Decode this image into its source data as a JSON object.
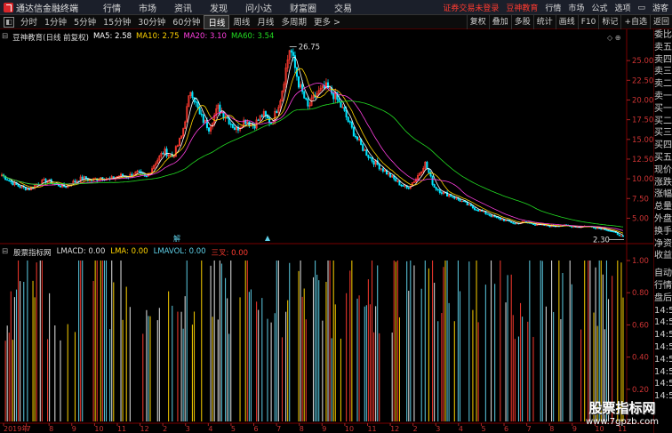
{
  "app": {
    "title": "通达信金融终端"
  },
  "top_menu": [
    "行情",
    "市场",
    "资讯",
    "发现",
    "问小达",
    "财富圈",
    "交易"
  ],
  "top_right": {
    "notice": "证券交易未登录",
    "brand": "豆神教育",
    "items": [
      "行情",
      "市场",
      "公式",
      "选项"
    ],
    "user": "游客"
  },
  "periods": [
    {
      "label": "分时",
      "active": false
    },
    {
      "label": "1分钟",
      "active": false
    },
    {
      "label": "5分钟",
      "active": false
    },
    {
      "label": "15分钟",
      "active": false
    },
    {
      "label": "30分钟",
      "active": false
    },
    {
      "label": "60分钟",
      "active": false
    },
    {
      "label": "日线",
      "active": true
    },
    {
      "label": "周线",
      "active": false
    },
    {
      "label": "月线",
      "active": false
    },
    {
      "label": "多周期",
      "active": false
    },
    {
      "label": "更多 >",
      "active": false
    }
  ],
  "toolbar_right": [
    "复权",
    "叠加",
    "多股",
    "统计",
    "画线",
    "F10",
    "标记",
    "+自选",
    "返回"
  ],
  "ma_legend": {
    "stock": "豆神教育(日线 前复权)",
    "items": [
      {
        "label": "MA5: 2.58",
        "color": "#ffffff"
      },
      {
        "label": "MA10: 2.75",
        "color": "#ffd400"
      },
      {
        "label": "MA20: 3.10",
        "color": "#ff3fe0"
      },
      {
        "label": "MA60: 3.54",
        "color": "#22dd22"
      }
    ]
  },
  "indicator_legend": {
    "name": "股票指标网",
    "items": [
      {
        "label": "LMACD: 0.00",
        "color": "#dddddd"
      },
      {
        "label": "LMA: 0.00",
        "color": "#ffd400"
      },
      {
        "label": "LMAVOL: 0.00",
        "color": "#5fd0e8"
      },
      {
        "label": "三叉: 0.00",
        "color": "#ff3b30"
      }
    ]
  },
  "chart_data": [
    {
      "type": "candlestick",
      "title": "豆神教育(日线 前复权)",
      "y_ticks": [
        5.0,
        7.5,
        10.0,
        12.5,
        15.0,
        17.5,
        20.0,
        22.5,
        25.0
      ],
      "ylim": [
        2.0,
        27.5
      ],
      "annotations": [
        {
          "label": "26.75",
          "value": 26.75
        },
        {
          "label": "2.30",
          "value": 2.3
        }
      ],
      "series": [
        {
          "name": "MA5",
          "color": "#ffffff"
        },
        {
          "name": "MA10",
          "color": "#ffd400"
        },
        {
          "name": "MA20",
          "color": "#ff3fe0"
        },
        {
          "name": "MA60",
          "color": "#22dd22"
        }
      ],
      "close_path": [
        10.5,
        9.6,
        9.0,
        8.7,
        9.4,
        9.8,
        9.3,
        9.0,
        9.6,
        10.1,
        9.8,
        10.2,
        9.9,
        10.4,
        10.3,
        10.8,
        10.1,
        12.0,
        13.5,
        12.8,
        15.5,
        21.5,
        18.0,
        16.5,
        19.0,
        17.8,
        16.2,
        17.5,
        16.8,
        18.2,
        17.0,
        20.5,
        26.75,
        22.0,
        19.0,
        20.8,
        21.6,
        20.5,
        18.5,
        16.0,
        14.0,
        12.5,
        11.5,
        10.5,
        9.5,
        8.8,
        10.0,
        12.0,
        9.0,
        8.2,
        7.8,
        7.2,
        6.5,
        6.0,
        5.5,
        5.0,
        4.7,
        4.3,
        4.5,
        4.3,
        4.1,
        4.0,
        4.1,
        4.0,
        3.9,
        4.0,
        3.8,
        3.6,
        3.2,
        2.6
      ]
    },
    {
      "type": "bar",
      "title": "股票指标网",
      "y_ticks": [
        0.2,
        0.4,
        0.6,
        0.8,
        1.0
      ],
      "ylim": [
        0,
        1.05
      ],
      "colors": [
        "#5fd0e8",
        "#e8e8e8",
        "#ffd400",
        "#ff3b30"
      ]
    }
  ],
  "x_axis": {
    "labels": [
      "2019年",
      "7",
      "8",
      "9",
      "10",
      "11",
      "12",
      "2",
      "3",
      "4",
      "5",
      "6",
      "7",
      "8",
      "9",
      "10",
      "11",
      "12",
      "2",
      "3",
      "4",
      "5",
      "6",
      "7",
      "8",
      "9",
      "10",
      "11"
    ]
  },
  "right_panel": [
    "委比",
    "卖五",
    "卖四",
    "卖三",
    "卖二",
    "卖一",
    "买一",
    "买二",
    "买三",
    "买四",
    "买五",
    "现价",
    "涨跌",
    "涨幅",
    "总量",
    "外盘",
    "换手",
    "净资",
    "收益",
    "",
    "自动",
    "行情",
    "盘后",
    "14:56",
    "14:56",
    "14:56",
    "14:56",
    "14:56",
    "14:56",
    "14:56",
    "14:56"
  ],
  "marker": "解",
  "watermark": {
    "line1": "股票指标网",
    "line2": "www.7gpzb.com"
  }
}
